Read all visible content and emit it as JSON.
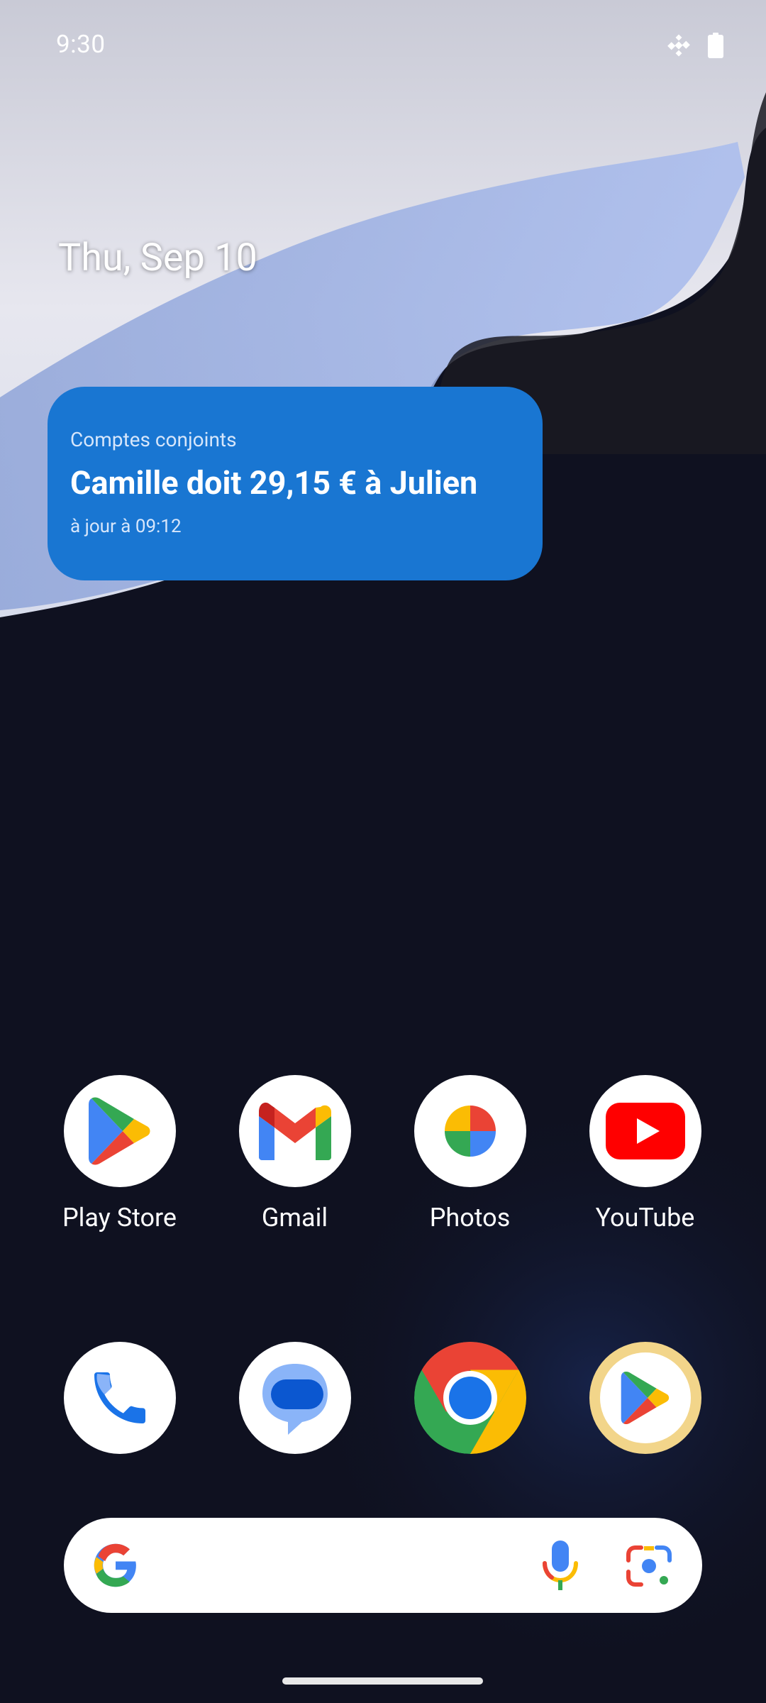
{
  "status_bar": {
    "time": "9:30",
    "icons": [
      "satellite-icon",
      "battery-icon"
    ]
  },
  "date": "Thu, Sep 10",
  "widget": {
    "title": "Comptes conjoints",
    "main": "Camille doit 29,15 € à Julien",
    "subtitle": "à jour à 09:12",
    "color": "#1976d2"
  },
  "apps": [
    {
      "label": "Play Store",
      "icon": "play-store-icon"
    },
    {
      "label": "Gmail",
      "icon": "gmail-icon"
    },
    {
      "label": "Photos",
      "icon": "photos-icon"
    },
    {
      "label": "YouTube",
      "icon": "youtube-icon"
    }
  ],
  "dock": [
    {
      "icon": "phone-icon"
    },
    {
      "icon": "messages-icon"
    },
    {
      "icon": "chrome-icon"
    },
    {
      "icon": "play-store-icon"
    }
  ],
  "search": {
    "icons": [
      "google-g-icon",
      "microphone-icon",
      "google-lens-icon"
    ]
  },
  "colors": {
    "widget_bg": "#1976d2",
    "google_blue": "#4285f4",
    "google_red": "#ea4335",
    "google_yellow": "#fbbc04",
    "google_green": "#34a853"
  }
}
